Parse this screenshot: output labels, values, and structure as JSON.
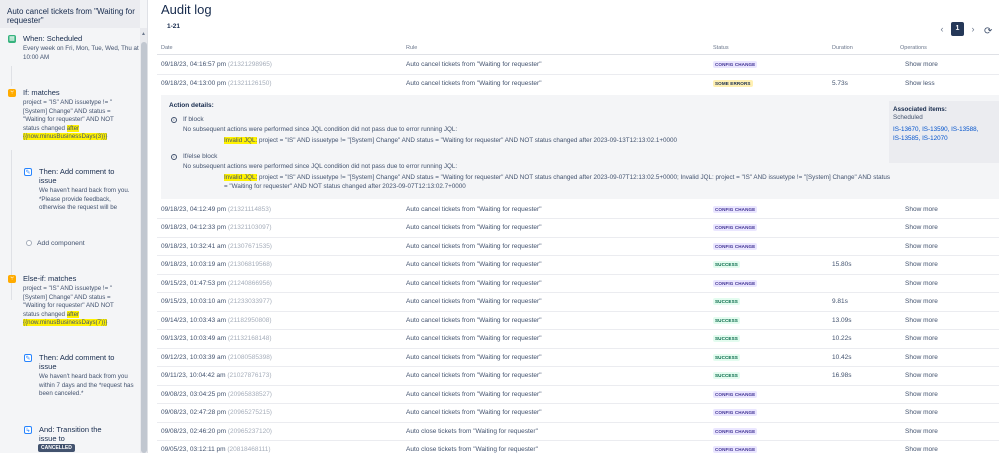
{
  "left_panel": {
    "title": "Auto cancel tickets from \"Waiting for requester\"",
    "when": {
      "title": "When: Scheduled",
      "desc": "Every week on Fri, Mon, Tue, Wed, Thu at 10:00 AM"
    },
    "if": {
      "title": "If: matches",
      "jql": "project = \"IS\" AND issuetype != \"[System] Change\" AND status = \"Waiting for requester\" AND NOT status changed",
      "jql_hl": "after {{now.minusBusinessDays(3)}}"
    },
    "then1": {
      "title": "Then: Add comment to issue",
      "desc": "We haven't heard back from you. *Please provide feedback, otherwise the request will be"
    },
    "add_component": "Add component",
    "elseif": {
      "title": "Else-if: matches",
      "jql": "project = \"IS\" AND issuetype != \"[System] Change\" AND status = \"Waiting for requester\" AND NOT status changed",
      "jql_hl": "after {{now.minusBusinessDays(7)}}"
    },
    "then2": {
      "title": "Then: Add comment to issue",
      "desc": "We haven't heard back from you within 7 days and the *request has been canceled.*"
    },
    "and": {
      "title": "And: Transition the issue to",
      "lozenge": "CANCELLED"
    }
  },
  "main": {
    "title": "Audit log",
    "range": "1-21",
    "page": "1",
    "columns": {
      "date": "Date",
      "rule": "Rule",
      "status": "Status",
      "duration": "Duration",
      "operations": "Operations"
    }
  },
  "rows_top": [
    {
      "date": "09/18/23, 04:16:57 pm",
      "id": "(21321298965)",
      "rule": "Auto cancel tickets from \"Waiting for requester\"",
      "status": "CONFIG CHANGE",
      "status_kind": "cfg",
      "duration": "",
      "op": "Show more"
    },
    {
      "date": "09/18/23, 04:13:00 pm",
      "id": "(21321126150)",
      "rule": "Auto cancel tickets from \"Waiting for requester\"",
      "status": "SOME ERRORS",
      "status_kind": "err",
      "duration": "5.73s",
      "op": "Show less"
    }
  ],
  "details": {
    "heading": "Action details:",
    "if_block": {
      "title": "If block",
      "message": "No subsequent actions were performed since JQL condition did not pass due to error running JQL:",
      "invalid": "Invalid JQL:",
      "jql": " project = \"IS\" AND issuetype != \"[System] Change\" AND status = \"Waiting for requester\" AND NOT status changed after 2023-09-13T12:13:02.1+0000"
    },
    "elseif_block": {
      "title": "If/else block",
      "message": "No subsequent actions were performed since JQL condition did not pass due to error running JQL:",
      "invalid": "Invalid JQL:",
      "jql_line1": " project = \"IS\" AND issuetype != \"[System] Change\" AND status = \"Waiting for requester\" AND NOT status changed after 2023-09-07T12:13:02.5+0000; Invalid JQL: project = \"IS\" AND issuetype != \"[System] Change\" AND status",
      "jql_line2": "= \"Waiting for requester\" AND NOT status changed after 2023-09-07T12:13:02.7+0000"
    },
    "associated": {
      "title": "Associated items:",
      "subtitle": "Scheduled",
      "links": [
        "IS-13670,",
        "IS-13590,",
        "IS-13588,",
        "IS-13585,",
        "IS-12070"
      ]
    }
  },
  "rows_bottom": [
    {
      "date": "09/18/23, 04:12:49 pm",
      "id": "(21321114853)",
      "rule": "Auto cancel tickets from \"Waiting for requester\"",
      "status": "CONFIG CHANGE",
      "status_kind": "cfg",
      "duration": "",
      "op": "Show more"
    },
    {
      "date": "09/18/23, 04:12:33 pm",
      "id": "(21321103097)",
      "rule": "Auto cancel tickets from \"Waiting for requester\"",
      "status": "CONFIG CHANGE",
      "status_kind": "cfg",
      "duration": "",
      "op": "Show more"
    },
    {
      "date": "09/18/23, 10:32:41 am",
      "id": "(21307671535)",
      "rule": "Auto cancel tickets from \"Waiting for requester\"",
      "status": "CONFIG CHANGE",
      "status_kind": "cfg",
      "duration": "",
      "op": "Show more"
    },
    {
      "date": "09/18/23, 10:03:19 am",
      "id": "(21306819568)",
      "rule": "Auto cancel tickets from \"Waiting for requester\"",
      "status": "SUCCESS",
      "status_kind": "ok",
      "duration": "15.80s",
      "op": "Show more"
    },
    {
      "date": "09/15/23, 01:47:53 pm",
      "id": "(21240866956)",
      "rule": "Auto cancel tickets from \"Waiting for requester\"",
      "status": "CONFIG CHANGE",
      "status_kind": "cfg",
      "duration": "",
      "op": "Show more"
    },
    {
      "date": "09/15/23, 10:03:10 am",
      "id": "(21233033977)",
      "rule": "Auto cancel tickets from \"Waiting for requester\"",
      "status": "SUCCESS",
      "status_kind": "ok",
      "duration": "9.81s",
      "op": "Show more"
    },
    {
      "date": "09/14/23, 10:03:43 am",
      "id": "(21182950808)",
      "rule": "Auto cancel tickets from \"Waiting for requester\"",
      "status": "SUCCESS",
      "status_kind": "ok",
      "duration": "13.09s",
      "op": "Show more"
    },
    {
      "date": "09/13/23, 10:03:49 am",
      "id": "(21132168148)",
      "rule": "Auto cancel tickets from \"Waiting for requester\"",
      "status": "SUCCESS",
      "status_kind": "ok",
      "duration": "10.22s",
      "op": "Show more"
    },
    {
      "date": "09/12/23, 10:03:39 am",
      "id": "(21080585398)",
      "rule": "Auto cancel tickets from \"Waiting for requester\"",
      "status": "SUCCESS",
      "status_kind": "ok",
      "duration": "10.42s",
      "op": "Show more"
    },
    {
      "date": "09/11/23, 10:04:42 am",
      "id": "(21027876173)",
      "rule": "Auto cancel tickets from \"Waiting for requester\"",
      "status": "SUCCESS",
      "status_kind": "ok",
      "duration": "16.98s",
      "op": "Show more"
    },
    {
      "date": "09/08/23, 03:04:25 pm",
      "id": "(20965838527)",
      "rule": "Auto cancel tickets from \"Waiting for requester\"",
      "status": "CONFIG CHANGE",
      "status_kind": "cfg",
      "duration": "",
      "op": "Show more"
    },
    {
      "date": "09/08/23, 02:47:28 pm",
      "id": "(20965275215)",
      "rule": "Auto cancel tickets from \"Waiting for requester\"",
      "status": "CONFIG CHANGE",
      "status_kind": "cfg",
      "duration": "",
      "op": "Show more"
    },
    {
      "date": "09/08/23, 02:46:20 pm",
      "id": "(20965237120)",
      "rule": "Auto close tickets from \"Waiting for requester\"",
      "status": "CONFIG CHANGE",
      "status_kind": "cfg",
      "duration": "",
      "op": "Show more"
    },
    {
      "date": "09/05/23, 03:12:11 pm",
      "id": "(20818468111)",
      "rule": "Auto close tickets from \"Waiting for requester\"",
      "status": "CONFIG CHANGE",
      "status_kind": "cfg",
      "duration": "",
      "op": "Show more"
    }
  ],
  "colors": {
    "accent": "#253858",
    "link": "#0052cc",
    "highlight": "#fff200"
  }
}
